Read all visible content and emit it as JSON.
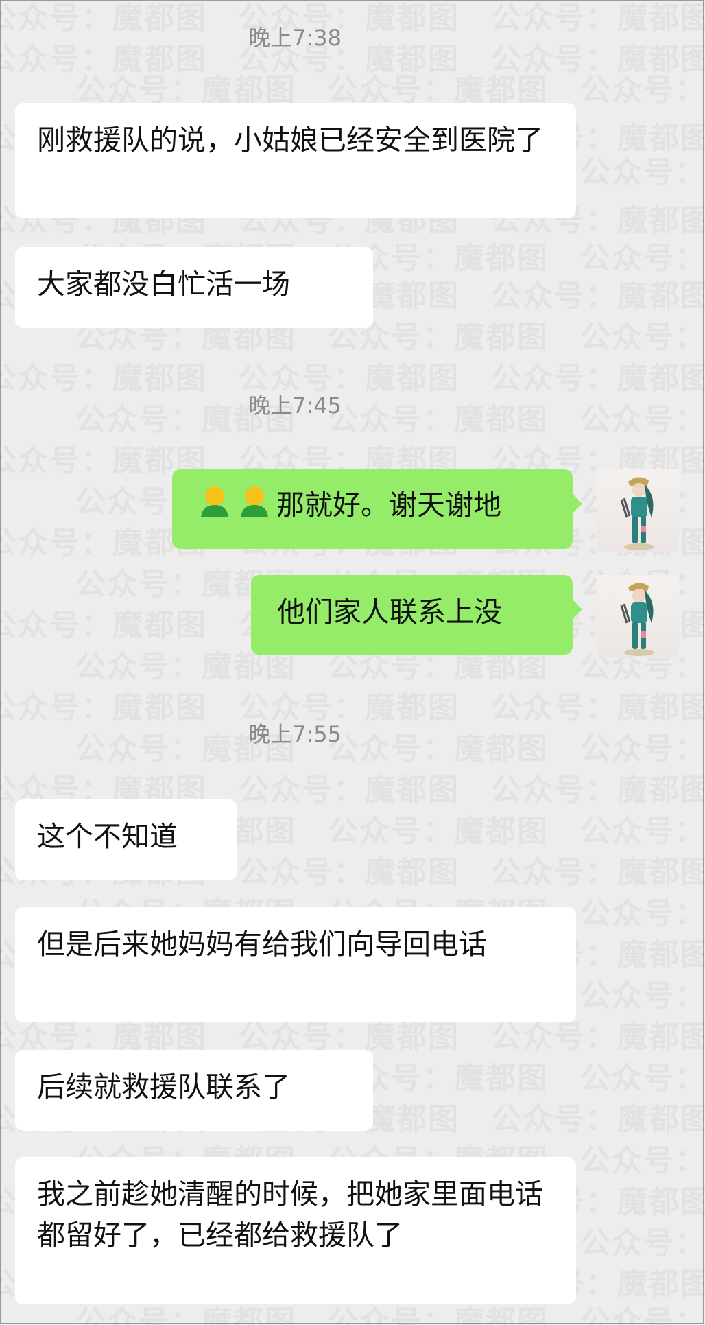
{
  "watermark": "公众号：魔都图",
  "messages": [
    {
      "type": "time",
      "text": "晚上7:38"
    },
    {
      "type": "in",
      "text": "刚救援队的说，小姑娘已经安全到医院了"
    },
    {
      "type": "in",
      "text": "大家都没白忙活一场"
    },
    {
      "type": "time",
      "text": "晚上7:45"
    },
    {
      "type": "out",
      "emoji": [
        "bow-emoji",
        "bow-emoji"
      ],
      "text": "那就好。谢天谢地"
    },
    {
      "type": "out",
      "text": "他们家人联系上没"
    },
    {
      "type": "time",
      "text": "晚上7:55"
    },
    {
      "type": "in",
      "text": "这个不知道"
    },
    {
      "type": "in",
      "text": "但是后来她妈妈有给我们向导回电话"
    },
    {
      "type": "in",
      "text": "后续就救援队联系了"
    },
    {
      "type": "in",
      "text": "我之前趁她清醒的时候，把她家里面电话都留好了，已经都给救援队了"
    }
  ],
  "colors": {
    "background": "#ededed",
    "incoming_bubble": "#ffffff",
    "outgoing_bubble": "#95ec69",
    "timestamp": "#8a8a8a"
  }
}
